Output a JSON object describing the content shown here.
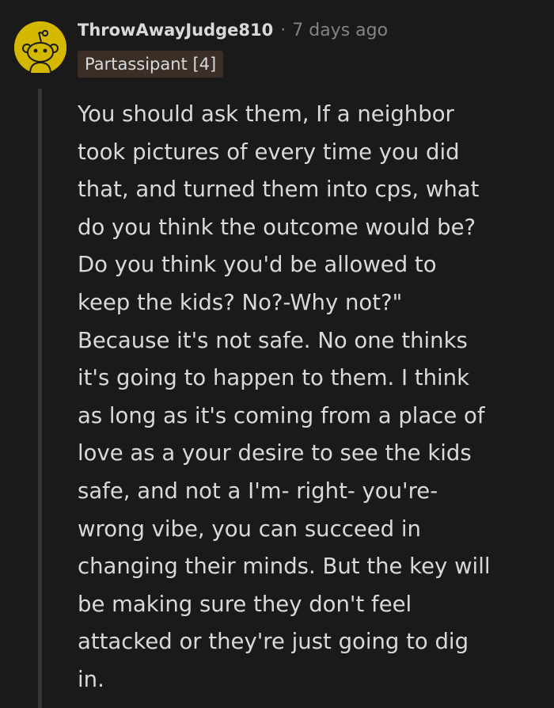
{
  "comment": {
    "author": "ThrowAwayJudge810",
    "separator": "·",
    "timestamp": "7 days ago",
    "flair": "Partassipant [4]",
    "avatar_icon": "snoo-avatar-icon",
    "avatar_color": "#d4b800",
    "body_lines": [
      "You should ask them, If a neighbor",
      "took pictures of every time you did",
      "that, and turned them into cps, what",
      "do you think the outcome would be?",
      "Do you think you'd be allowed to",
      "keep the kids? No?-Why not?\"",
      "Because it's not safe. No one thinks",
      "it's going to happen to them. I think",
      "as long as it's coming from a place of",
      "love as a your desire to see the kids",
      "safe, and not a I'm- right- you're-",
      "wrong vibe, you can succeed in",
      "changing their minds. But the key will",
      "be making sure they don't feel",
      "attacked or they're just going to dig",
      "in."
    ]
  },
  "colors": {
    "background": "#1a1a1b",
    "text": "#d7dadc",
    "meta": "#818384",
    "flair_bg": "#3a2e26",
    "thread_line": "#343536"
  }
}
